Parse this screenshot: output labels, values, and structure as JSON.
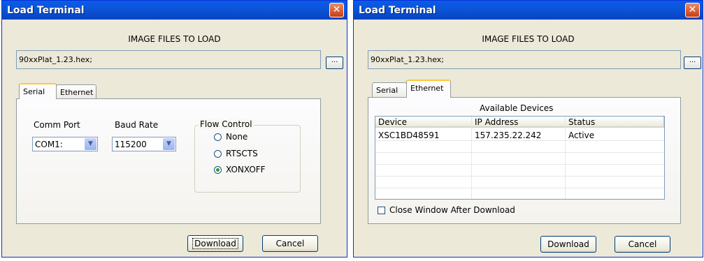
{
  "serial_window": {
    "title": "Load Terminal",
    "close_glyph": "✕",
    "heading": "IMAGE FILES TO LOAD",
    "file_value": "90xxPlat_1.23.hex;",
    "browse_label": "...",
    "tabs": [
      {
        "label": "Serial"
      },
      {
        "label": "Ethernet"
      }
    ],
    "comm_port": {
      "label": "Comm Port",
      "value": "COM1:"
    },
    "baud_rate": {
      "label": "Baud Rate",
      "value": "115200"
    },
    "flow_control": {
      "label": "Flow Control",
      "options": [
        {
          "label": "None"
        },
        {
          "label": "RTSCTS"
        },
        {
          "label": "XONXOFF"
        }
      ],
      "selected": "XONXOFF"
    },
    "download_label": "Download",
    "cancel_label": "Cancel"
  },
  "ethernet_window": {
    "title": "Load Terminal",
    "close_glyph": "✕",
    "heading": "IMAGE FILES TO LOAD",
    "file_value": "90xxPlat_1.23.hex;",
    "browse_label": "...",
    "tabs": [
      {
        "label": "Serial"
      },
      {
        "label": "Ethernet"
      }
    ],
    "devices_label": "Available Devices",
    "columns": [
      "Device",
      "IP Address",
      "Status"
    ],
    "rows": [
      {
        "device": "XSC1BD48591",
        "ip": "157.235.22.242",
        "status": "Active"
      }
    ],
    "close_after_label": "Close Window After Download",
    "close_after_checked": false,
    "download_label": "Download",
    "cancel_label": "Cancel"
  },
  "colors": {
    "title_bar": "#0b53d6",
    "dialog_bg": "#ece9d8",
    "close_button": "#c83c14",
    "tab_highlight": "#ffc83c"
  }
}
